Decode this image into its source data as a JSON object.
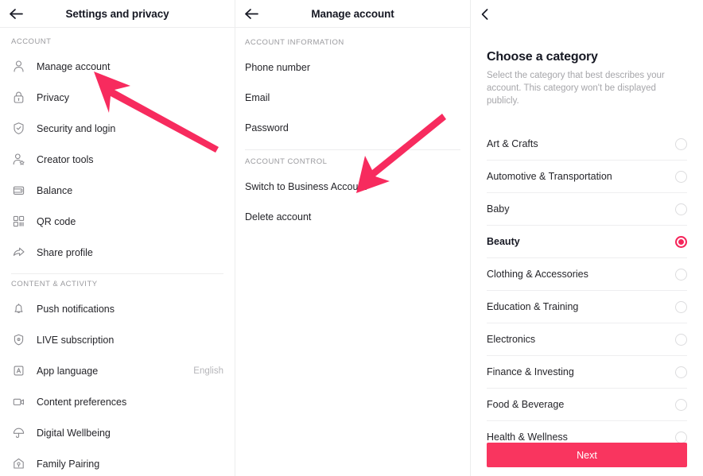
{
  "accent_color": "#f5265b",
  "next_button_color": "#f9355f",
  "annotation_arrow_color": "#f72b5e",
  "settings_panel": {
    "back_icon": "arrow-left-icon",
    "title": "Settings and privacy",
    "sections": [
      {
        "label": "ACCOUNT",
        "items": [
          {
            "icon": "person-icon",
            "label": "Manage account",
            "value": ""
          },
          {
            "icon": "lock-icon",
            "label": "Privacy",
            "value": ""
          },
          {
            "icon": "shield-check-icon",
            "label": "Security and login",
            "value": ""
          },
          {
            "icon": "person-star-icon",
            "label": "Creator tools",
            "value": ""
          },
          {
            "icon": "wallet-icon",
            "label": "Balance",
            "value": ""
          },
          {
            "icon": "qr-code-icon",
            "label": "QR code",
            "value": ""
          },
          {
            "icon": "share-arrow-icon",
            "label": "Share profile",
            "value": ""
          }
        ]
      },
      {
        "label": "CONTENT & ACTIVITY",
        "items": [
          {
            "icon": "bell-icon",
            "label": "Push notifications",
            "value": ""
          },
          {
            "icon": "live-shield-icon",
            "label": "LIVE subscription",
            "value": ""
          },
          {
            "icon": "language-a-icon",
            "label": "App language",
            "value": "English"
          },
          {
            "icon": "video-screen-icon",
            "label": "Content preferences",
            "value": ""
          },
          {
            "icon": "umbrella-icon",
            "label": "Digital Wellbeing",
            "value": ""
          },
          {
            "icon": "home-shield-icon",
            "label": "Family Pairing",
            "value": ""
          }
        ]
      }
    ]
  },
  "manage_panel": {
    "back_icon": "arrow-left-icon",
    "title": "Manage account",
    "sections": [
      {
        "label": "ACCOUNT INFORMATION",
        "items": [
          {
            "label": "Phone number"
          },
          {
            "label": "Email"
          },
          {
            "label": "Password"
          }
        ]
      },
      {
        "label": "ACCOUNT CONTROL",
        "items": [
          {
            "label": "Switch to Business Account"
          },
          {
            "label": "Delete account"
          }
        ]
      }
    ]
  },
  "category_panel": {
    "back_icon": "chevron-left-icon",
    "title": "Choose a category",
    "description": "Select the category that best describes your account. This category won't be displayed publicly.",
    "categories": [
      {
        "label": "Art & Crafts",
        "selected": false
      },
      {
        "label": "Automotive & Transportation",
        "selected": false
      },
      {
        "label": "Baby",
        "selected": false
      },
      {
        "label": "Beauty",
        "selected": true
      },
      {
        "label": "Clothing & Accessories",
        "selected": false
      },
      {
        "label": "Education & Training",
        "selected": false
      },
      {
        "label": "Electronics",
        "selected": false
      },
      {
        "label": "Finance & Investing",
        "selected": false
      },
      {
        "label": "Food & Beverage",
        "selected": false
      },
      {
        "label": "Health & Wellness",
        "selected": false
      }
    ],
    "next_label": "Next"
  }
}
